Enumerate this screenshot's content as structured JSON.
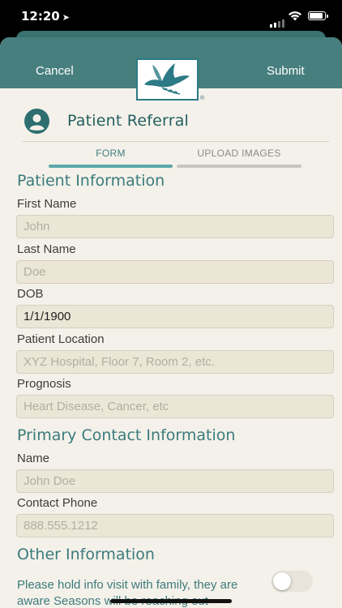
{
  "status": {
    "time": "12:20"
  },
  "header": {
    "cancel_label": "Cancel",
    "submit_label": "Submit"
  },
  "page": {
    "title": "Patient Referral"
  },
  "tabs": [
    {
      "label": "FORM",
      "active": true
    },
    {
      "label": "UPLOAD IMAGES",
      "active": false
    }
  ],
  "patient_info": {
    "heading": "Patient Information",
    "first_name": {
      "label": "First Name",
      "value": "",
      "placeholder": "John"
    },
    "last_name": {
      "label": "Last Name",
      "value": "",
      "placeholder": "Doe"
    },
    "dob": {
      "label": "DOB",
      "value": "1/1/1900",
      "placeholder": ""
    },
    "location": {
      "label": "Patient Location",
      "value": "",
      "placeholder": "XYZ Hospital, Floor 7, Room 2, etc."
    },
    "prognosis": {
      "label": "Prognosis",
      "value": "",
      "placeholder": "Heart Disease, Cancer, etc"
    }
  },
  "primary_contact": {
    "heading": "Primary Contact Information",
    "name": {
      "label": "Name",
      "value": "",
      "placeholder": "John Doe"
    },
    "phone": {
      "label": "Contact Phone",
      "value": "",
      "placeholder": "888.555.1212"
    }
  },
  "other_info": {
    "heading": "Other Information",
    "hold_info_label": "Please hold info visit with family, they are aware Seasons will be reaching out",
    "hold_info_on": false
  },
  "colors": {
    "header": "#467f7d",
    "accent": "#3a7b7c",
    "background": "#f4f1ea",
    "field": "#ebe6d6"
  }
}
